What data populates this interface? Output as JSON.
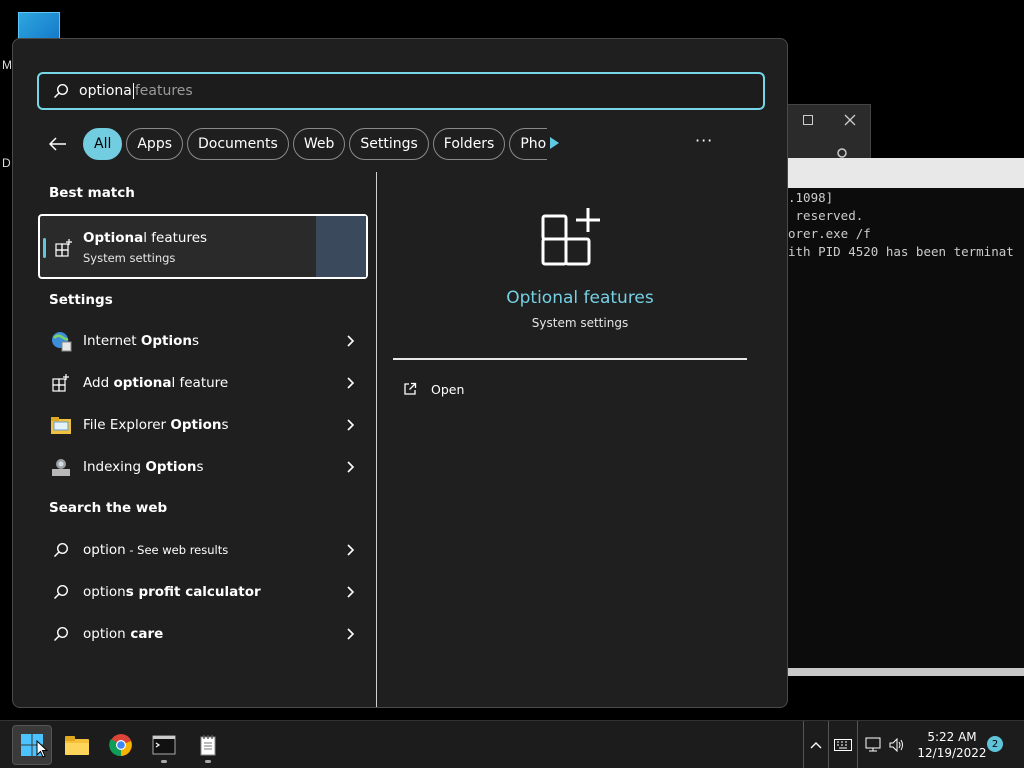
{
  "desktop": {
    "label_m": "M",
    "label_d": "D"
  },
  "terminal": {
    "lines": [
      ".1098]",
      " reserved.",
      "",
      "orer.exe /f",
      "ith PID 4520 has been terminat"
    ]
  },
  "search": {
    "typed": "optiona",
    "suggestion": " features"
  },
  "filters": {
    "chips": [
      "All",
      "Apps",
      "Documents",
      "Web",
      "Settings",
      "Folders",
      "Pho"
    ],
    "more": "···"
  },
  "best_match": {
    "heading": "Best match",
    "title_bold": "Optiona",
    "title_rest": "l features",
    "subtitle": "System settings"
  },
  "settings": {
    "heading": "Settings",
    "items": [
      {
        "pre": "Internet ",
        "bold": "Option",
        "post": "s",
        "icon": "globe-icon"
      },
      {
        "pre": "Add ",
        "bold": "optiona",
        "post": "l feature",
        "icon": "optional-features-icon"
      },
      {
        "pre": "File Explorer ",
        "bold": "Option",
        "post": "s",
        "icon": "folder-icon"
      },
      {
        "pre": "Indexing ",
        "bold": "Option",
        "post": "s",
        "icon": "indexing-icon"
      }
    ]
  },
  "web": {
    "heading": "Search the web",
    "items": [
      {
        "pre": "option",
        "bold": "",
        "post": " - See web results"
      },
      {
        "pre": "option",
        "bold": "s profit calculator",
        "post": ""
      },
      {
        "pre": "option",
        "bold": " care",
        "post": ""
      }
    ]
  },
  "detail": {
    "title": "Optional features",
    "subtitle": "System settings",
    "open_label": "Open"
  },
  "taskbar": {
    "time": "5:22 AM",
    "date": "12/19/2022",
    "notification_count": "2"
  },
  "colors": {
    "accent": "#76d6e8",
    "menu_bg": "#1f1f1f"
  }
}
